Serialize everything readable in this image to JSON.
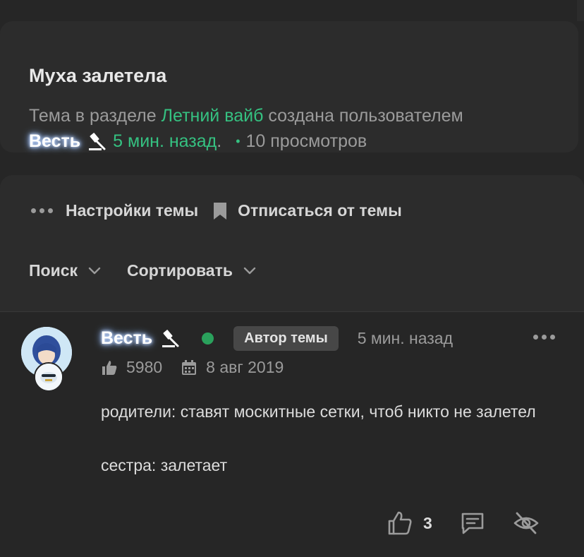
{
  "topic": {
    "title": "Муха залетела",
    "meta_prefix": "Тема в разделе",
    "section": "Летний вайб",
    "meta_created": "создана пользователем",
    "author": "Весть",
    "time": "5 мин. назад",
    "time_suffix": ".",
    "views": "10 просмотров"
  },
  "actions": {
    "settings": "Настройки темы",
    "unsubscribe": "Отписаться от темы"
  },
  "filters": {
    "search": "Поиск",
    "sort": "Сортировать"
  },
  "post": {
    "author": "Весть",
    "author_tag": "Автор темы",
    "time": "5 мин. назад",
    "likes_total": "5980",
    "joined": "8 авг 2019",
    "text_line1": "родители: ставят москитные сетки, чтоб никто не залетел",
    "text_line2": "сестра: залетает",
    "likes": "3"
  },
  "colors": {
    "accent_green": "#35c181",
    "online": "#2aa15c",
    "background": "#262626",
    "card": "#2c2c2c"
  },
  "icons": [
    "dots-icon",
    "bookmark-icon",
    "chevron-down-icon",
    "hammer-icon",
    "thumbs-up-icon",
    "calendar-icon",
    "like-outline-icon",
    "comment-icon",
    "eye-off-icon"
  ]
}
